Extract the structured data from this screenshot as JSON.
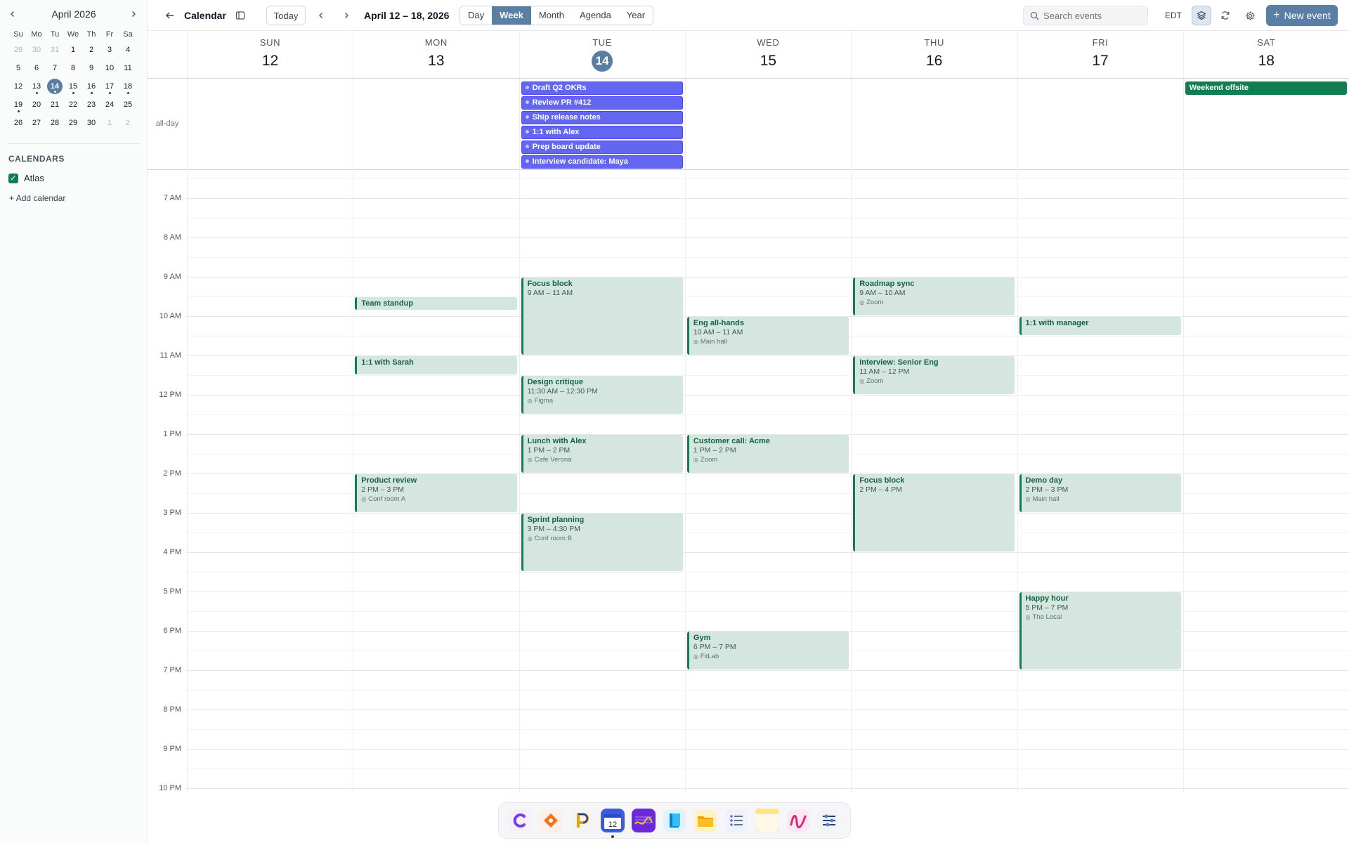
{
  "sidebar": {
    "month_title": "April 2026",
    "weekdays": [
      "Su",
      "Mo",
      "Tu",
      "We",
      "Th",
      "Fr",
      "Sa"
    ],
    "weeks": [
      [
        {
          "d": "29",
          "m": 1
        },
        {
          "d": "30",
          "m": 1
        },
        {
          "d": "31",
          "m": 1
        },
        {
          "d": "1"
        },
        {
          "d": "2"
        },
        {
          "d": "3"
        },
        {
          "d": "4"
        }
      ],
      [
        {
          "d": "5"
        },
        {
          "d": "6"
        },
        {
          "d": "7"
        },
        {
          "d": "8"
        },
        {
          "d": "9"
        },
        {
          "d": "10"
        },
        {
          "d": "11"
        }
      ],
      [
        {
          "d": "12"
        },
        {
          "d": "13",
          "dot": 1
        },
        {
          "d": "14",
          "today": 1,
          "dot": 1
        },
        {
          "d": "15",
          "dot": 1
        },
        {
          "d": "16",
          "dot": 1
        },
        {
          "d": "17",
          "dot": 1
        },
        {
          "d": "18",
          "dot": 1
        }
      ],
      [
        {
          "d": "19",
          "dot": 1
        },
        {
          "d": "20"
        },
        {
          "d": "21"
        },
        {
          "d": "22"
        },
        {
          "d": "23"
        },
        {
          "d": "24"
        },
        {
          "d": "25"
        }
      ],
      [
        {
          "d": "26"
        },
        {
          "d": "27"
        },
        {
          "d": "28"
        },
        {
          "d": "29"
        },
        {
          "d": "30"
        },
        {
          "d": "1",
          "m": 1
        },
        {
          "d": "2",
          "m": 1
        }
      ]
    ],
    "calendars_title": "CALENDARS",
    "calendar_name": "Atlas",
    "add_calendar": "Add calendar"
  },
  "toolbar": {
    "title": "Calendar",
    "today": "Today",
    "range": "April 12 – 18, 2026",
    "views": [
      "Day",
      "Week",
      "Month",
      "Agenda",
      "Year"
    ],
    "active_view": "Week",
    "search_placeholder": "Search events",
    "timezone": "EDT",
    "new_event": "New event"
  },
  "days": [
    {
      "dow": "SUN",
      "num": "12"
    },
    {
      "dow": "MON",
      "num": "13"
    },
    {
      "dow": "TUE",
      "num": "14",
      "today": true
    },
    {
      "dow": "WED",
      "num": "15"
    },
    {
      "dow": "THU",
      "num": "16"
    },
    {
      "dow": "FRI",
      "num": "17"
    },
    {
      "dow": "SAT",
      "num": "18"
    }
  ],
  "allday_label": "all-day",
  "allday_events": [
    {
      "day": 2,
      "row": 0,
      "title": "Draft Q2 OKRs",
      "color": "purple"
    },
    {
      "day": 2,
      "row": 1,
      "title": "Review PR #412",
      "color": "purple"
    },
    {
      "day": 2,
      "row": 2,
      "title": "Ship release notes",
      "color": "purple"
    },
    {
      "day": 2,
      "row": 3,
      "title": "1:1 with Alex",
      "color": "purple"
    },
    {
      "day": 2,
      "row": 4,
      "title": "Prep board update",
      "color": "purple"
    },
    {
      "day": 2,
      "row": 5,
      "title": "Interview candidate: Maya",
      "color": "purple"
    },
    {
      "day": 6,
      "row": 0,
      "title": "Weekend offsite",
      "color": "green"
    }
  ],
  "hours": [
    "7 AM",
    "8 AM",
    "9 AM",
    "10 AM",
    "11 AM",
    "12 PM",
    "1 PM",
    "2 PM",
    "3 PM",
    "4 PM",
    "5 PM",
    "6 PM",
    "7 PM",
    "8 PM",
    "9 PM",
    "10 PM"
  ],
  "grid_start_hour": 6.3,
  "events": [
    {
      "day": 1,
      "start": 9.5,
      "end": 9.85,
      "title": "Team standup"
    },
    {
      "day": 1,
      "start": 11,
      "end": 11.5,
      "title": "1:1 with Sarah"
    },
    {
      "day": 1,
      "start": 14,
      "end": 15,
      "title": "Product review",
      "time": "2 PM – 3 PM",
      "location": "Conf room A"
    },
    {
      "day": 2,
      "start": 9,
      "end": 11,
      "title": "Focus block",
      "time": "9 AM – 11 AM"
    },
    {
      "day": 2,
      "start": 11.5,
      "end": 12.5,
      "title": "Design critique",
      "time": "11:30 AM – 12:30 PM",
      "location": "Figma"
    },
    {
      "day": 2,
      "start": 13,
      "end": 14,
      "title": "Lunch with Alex",
      "time": "1 PM – 2 PM",
      "location": "Cafe Verona"
    },
    {
      "day": 2,
      "start": 15,
      "end": 16.5,
      "title": "Sprint planning",
      "time": "3 PM – 4:30 PM",
      "location": "Conf room B"
    },
    {
      "day": 3,
      "start": 10,
      "end": 11,
      "title": "Eng all-hands",
      "time": "10 AM – 11 AM",
      "location": "Main hall"
    },
    {
      "day": 3,
      "start": 13,
      "end": 14,
      "title": "Customer call: Acme",
      "time": "1 PM – 2 PM",
      "location": "Zoom"
    },
    {
      "day": 3,
      "start": 18,
      "end": 19,
      "title": "Gym",
      "time": "6 PM – 7 PM",
      "location": "FitLab"
    },
    {
      "day": 4,
      "start": 9,
      "end": 10,
      "title": "Roadmap sync",
      "time": "9 AM – 10 AM",
      "location": "Zoom"
    },
    {
      "day": 4,
      "start": 11,
      "end": 12,
      "title": "Interview: Senior Eng",
      "time": "11 AM – 12 PM",
      "location": "Zoom"
    },
    {
      "day": 4,
      "start": 14,
      "end": 16,
      "title": "Focus block",
      "time": "2 PM – 4 PM"
    },
    {
      "day": 5,
      "start": 10,
      "end": 10.5,
      "title": "1:1 with manager"
    },
    {
      "day": 5,
      "start": 14,
      "end": 15,
      "title": "Demo day",
      "time": "2 PM – 3 PM",
      "location": "Main hall"
    },
    {
      "day": 5,
      "start": 17,
      "end": 19,
      "title": "Happy hour",
      "time": "5 PM – 7 PM",
      "location": "The Local"
    }
  ],
  "dock_date": "12",
  "colors": {
    "accent": "#5b7ea4",
    "event_bg": "#d4e6df",
    "event_border": "#137d52",
    "allday_purple": "#6366f1"
  }
}
